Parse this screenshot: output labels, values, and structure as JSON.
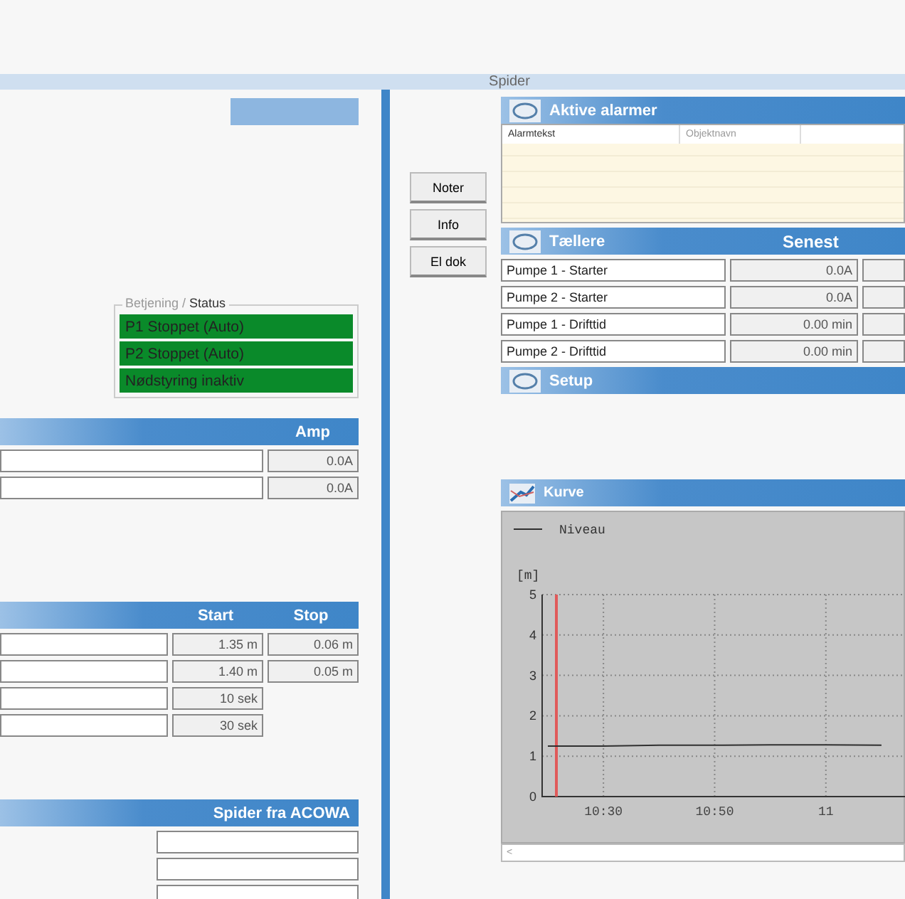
{
  "window": {
    "title": "Spider"
  },
  "status_group": {
    "legend_prefix": "Betjening /",
    "legend": "Status",
    "items": [
      {
        "text": "P1  Stoppet (Auto)",
        "color": "#0a8a2a"
      },
      {
        "text": "P2  Stoppet (Auto)",
        "color": "#0a8a2a"
      },
      {
        "text": "Nødstyring inaktiv",
        "color": "#0a8a2a"
      }
    ]
  },
  "amp_section": {
    "header": "Amp",
    "rows": [
      {
        "value": "0.0A"
      },
      {
        "value": "0.0A"
      }
    ]
  },
  "level_section": {
    "headers": [
      "Start",
      "Stop"
    ],
    "rows": [
      {
        "start": "1.35 m",
        "stop": "0.06 m"
      },
      {
        "start": "1.40 m",
        "stop": "0.05 m"
      },
      {
        "start": "10 sek"
      },
      {
        "start": "30 sek"
      }
    ]
  },
  "acowa_section": {
    "header": "Spider fra ACOWA"
  },
  "side_buttons": [
    "Noter",
    "Info",
    "El dok"
  ],
  "alarms": {
    "title": "Aktive alarmer",
    "columns": [
      "Alarmtekst",
      "Objektnavn"
    ]
  },
  "counters": {
    "title": "Tællere",
    "column": "Senest",
    "rows": [
      {
        "name": "Pumpe 1 - Starter",
        "value": "0.0A"
      },
      {
        "name": "Pumpe 2 - Starter",
        "value": "0.0A"
      },
      {
        "name": "Pumpe 1 - Drifttid",
        "value": "0.00 min"
      },
      {
        "name": "Pumpe 2 - Drifttid",
        "value": "0.00 min"
      }
    ]
  },
  "setup": {
    "title": "Setup"
  },
  "curve": {
    "title": "Kurve",
    "chart_data": {
      "type": "line",
      "ylabel": "[m]",
      "ylim": [
        0,
        5
      ],
      "yticks": [
        0,
        1,
        2,
        3,
        4,
        5
      ],
      "grid": true,
      "categories": [
        null,
        "10:30",
        null,
        "10:50",
        null,
        "11",
        null
      ],
      "series": [
        {
          "name": "Niveau",
          "color": "#303030",
          "values": [
            1.25,
            1.25,
            1.27,
            1.27,
            1.28,
            1.28,
            1.27
          ]
        }
      ]
    },
    "scroll_arrow": "<"
  }
}
